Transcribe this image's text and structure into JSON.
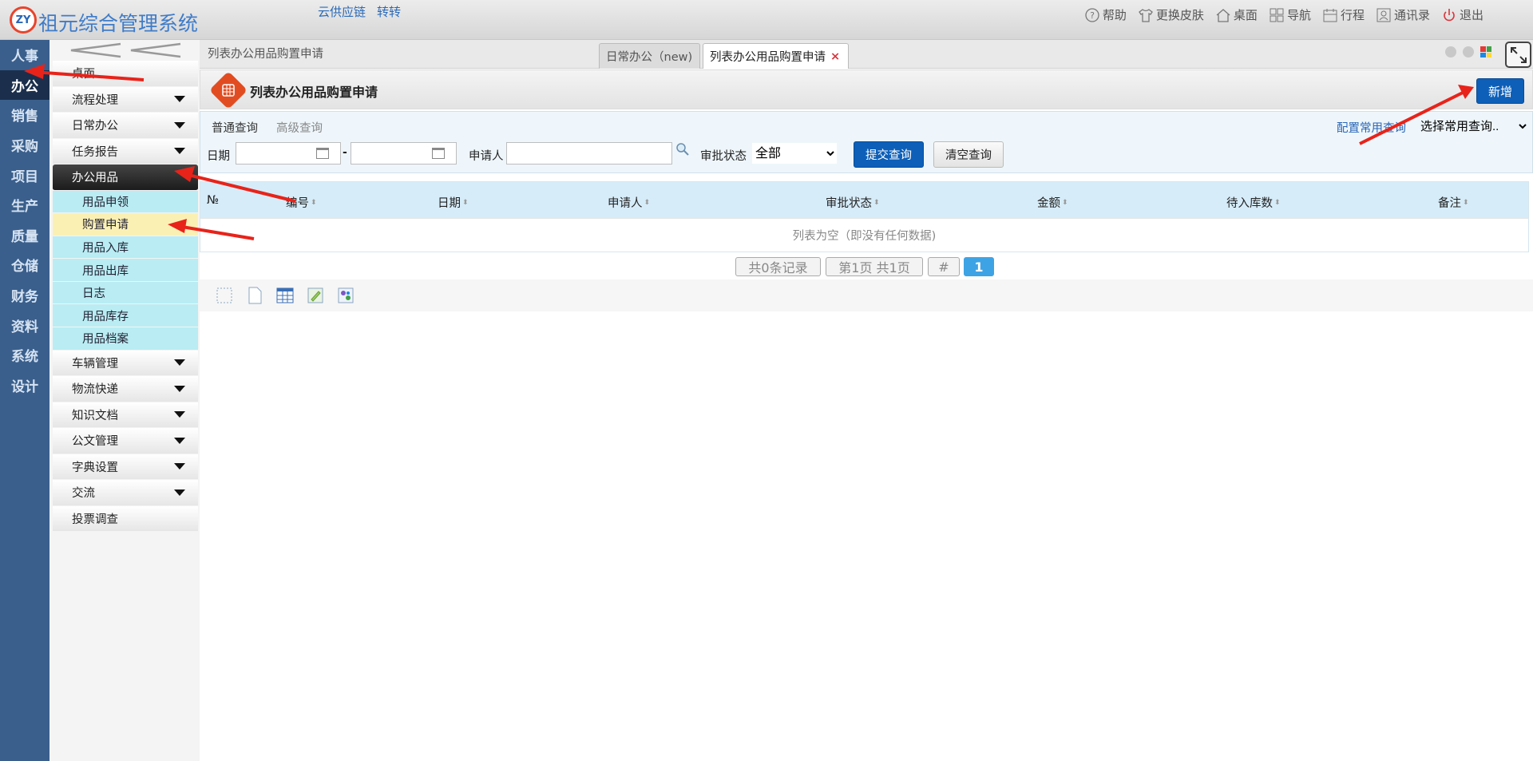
{
  "app": {
    "title": "祖元综合管理系统",
    "logo_text": "ZY"
  },
  "top_links": [
    "云供应链",
    "转转"
  ],
  "top_actions": [
    {
      "icon": "help-icon",
      "label": "帮助"
    },
    {
      "icon": "shirt-icon",
      "label": "更换皮肤"
    },
    {
      "icon": "home-icon",
      "label": "桌面"
    },
    {
      "icon": "grid-icon",
      "label": "导航"
    },
    {
      "icon": "calendar-icon",
      "label": "行程"
    },
    {
      "icon": "contacts-icon",
      "label": "通讯录"
    },
    {
      "icon": "power-icon",
      "label": "退出"
    }
  ],
  "rail": [
    "人事",
    "办公",
    "销售",
    "采购",
    "项目",
    "生产",
    "质量",
    "仓储",
    "财务",
    "资料",
    "系统",
    "设计"
  ],
  "rail_active": "办公",
  "menu": {
    "desktop": "桌面",
    "items_before": [
      "流程处理",
      "日常办公",
      "任务报告"
    ],
    "open_group": "办公用品",
    "sub_items": [
      "用品申领",
      "购置申请",
      "用品入库",
      "用品出库",
      "日志",
      "用品库存",
      "用品档案"
    ],
    "sub_active": "购置申请",
    "items_after": [
      "车辆管理",
      "物流快递",
      "知识文档",
      "公文管理",
      "字典设置",
      "交流"
    ],
    "last_item": "投票调查"
  },
  "breadcrumb": "列表办公用品购置申请",
  "tabs": {
    "inactive": "日常办公（new)",
    "active": "列表办公用品购置申请",
    "close": "×"
  },
  "page": {
    "title": "列表办公用品购置申请",
    "new_button": "新增"
  },
  "query": {
    "tab_normal": "普通查询",
    "tab_advanced": "高级查询",
    "config_link": "配置常用查询",
    "common_select": "选择常用查询..",
    "date_label": "日期",
    "date_from": "",
    "date_to": "",
    "dash": "-",
    "applicant_label": "申请人",
    "applicant_value": "",
    "status_label": "审批状态",
    "status_value": "全部",
    "submit": "提交查询",
    "clear": "清空查询"
  },
  "table": {
    "columns": [
      "№",
      "编号",
      "日期",
      "申请人",
      "审批状态",
      "金额",
      "待入库数",
      "备注"
    ],
    "empty_text": "列表为空（即没有任何数据)"
  },
  "pager": {
    "total": "共0条记录",
    "page": "第1页 共1页",
    "jump": "#",
    "current": "1"
  },
  "colors": {
    "accent": "#0d5fb8",
    "rail": "#3a5f8c",
    "arrow": "#e8231a"
  }
}
